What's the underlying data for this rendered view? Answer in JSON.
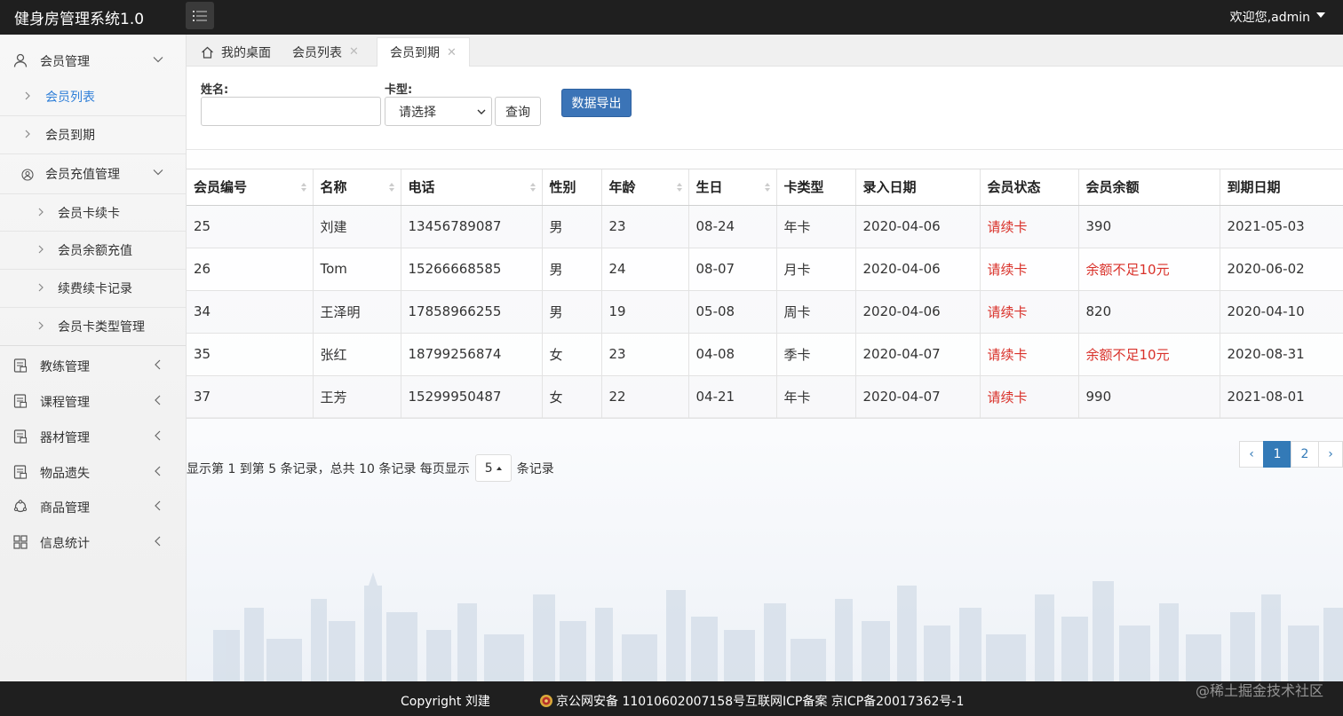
{
  "header": {
    "title": "健身房管理系统1.0",
    "user_label": "欢迎您,admin"
  },
  "sidebar": {
    "groups": [
      {
        "label": "会员管理",
        "icon": "user-icon"
      },
      {
        "label": "教练管理",
        "icon": "document-icon"
      },
      {
        "label": "课程管理",
        "icon": "document-icon"
      },
      {
        "label": "器材管理",
        "icon": "document-icon"
      },
      {
        "label": "物品遗失",
        "icon": "document-icon"
      },
      {
        "label": "商品管理",
        "icon": "cycle-icon"
      },
      {
        "label": "信息统计",
        "icon": "grid-icon"
      }
    ],
    "member_sub": [
      {
        "label": "会员列表"
      },
      {
        "label": "会员到期"
      }
    ],
    "recharge_group": {
      "label": "会员充值管理",
      "icon": "user-circle-icon"
    },
    "recharge_sub": [
      {
        "label": "会员卡续卡"
      },
      {
        "label": "会员余额充值"
      },
      {
        "label": "续费续卡记录"
      },
      {
        "label": "会员卡类型管理"
      }
    ]
  },
  "tabs": [
    {
      "label": "我的桌面"
    },
    {
      "label": "会员列表"
    },
    {
      "label": "会员到期"
    }
  ],
  "filter": {
    "name_label": "姓名:",
    "card_label": "卡型:",
    "card_value": "请选择",
    "query_label": "查询",
    "export_label": "数据导出"
  },
  "table": {
    "columns": [
      "会员编号",
      "名称",
      "电话",
      "性别",
      "年龄",
      "生日",
      "卡类型",
      "录入日期",
      "会员状态",
      "会员余额",
      "到期日期"
    ],
    "rows": [
      [
        "25",
        "刘建",
        "13456789087",
        "男",
        "23",
        "08-24",
        "年卡",
        "2020-04-06",
        "请续卡",
        "390",
        "2021-05-03"
      ],
      [
        "26",
        "Tom",
        "15266668585",
        "男",
        "24",
        "08-07",
        "月卡",
        "2020-04-06",
        "请续卡",
        "余额不足10元",
        "2020-06-02"
      ],
      [
        "34",
        "王泽明",
        "17858966255",
        "男",
        "19",
        "05-08",
        "周卡",
        "2020-04-06",
        "请续卡",
        "820",
        "2020-04-10"
      ],
      [
        "35",
        "张红",
        "18799256874",
        "女",
        "23",
        "04-08",
        "季卡",
        "2020-04-07",
        "请续卡",
        "余额不足10元",
        "2020-08-31"
      ],
      [
        "37",
        "王芳",
        "15299950487",
        "女",
        "22",
        "04-21",
        "年卡",
        "2020-04-07",
        "请续卡",
        "990",
        "2021-08-01"
      ]
    ]
  },
  "pagination": {
    "info_prefix": "显示第 1 到第 5 条记录，总共 10 条记录 每页显示",
    "page_size": "5",
    "info_suffix": "条记录",
    "prev": "‹",
    "next": "›",
    "pages": [
      "1",
      "2"
    ],
    "current": "1"
  },
  "footer": {
    "copyright": "Copyright 刘建",
    "police_record": "京公网安备 11010602007158号",
    "icp": "互联网ICP备案 京ICP备20017362号-1",
    "watermark": "@稀土掘金技术社区"
  },
  "colors": {
    "header_bg": "#1f1f1f",
    "accent": "#337ab7",
    "export_button": "#3b74b7",
    "danger_text": "#d9312a",
    "active_nav": "#2f7fd8"
  }
}
